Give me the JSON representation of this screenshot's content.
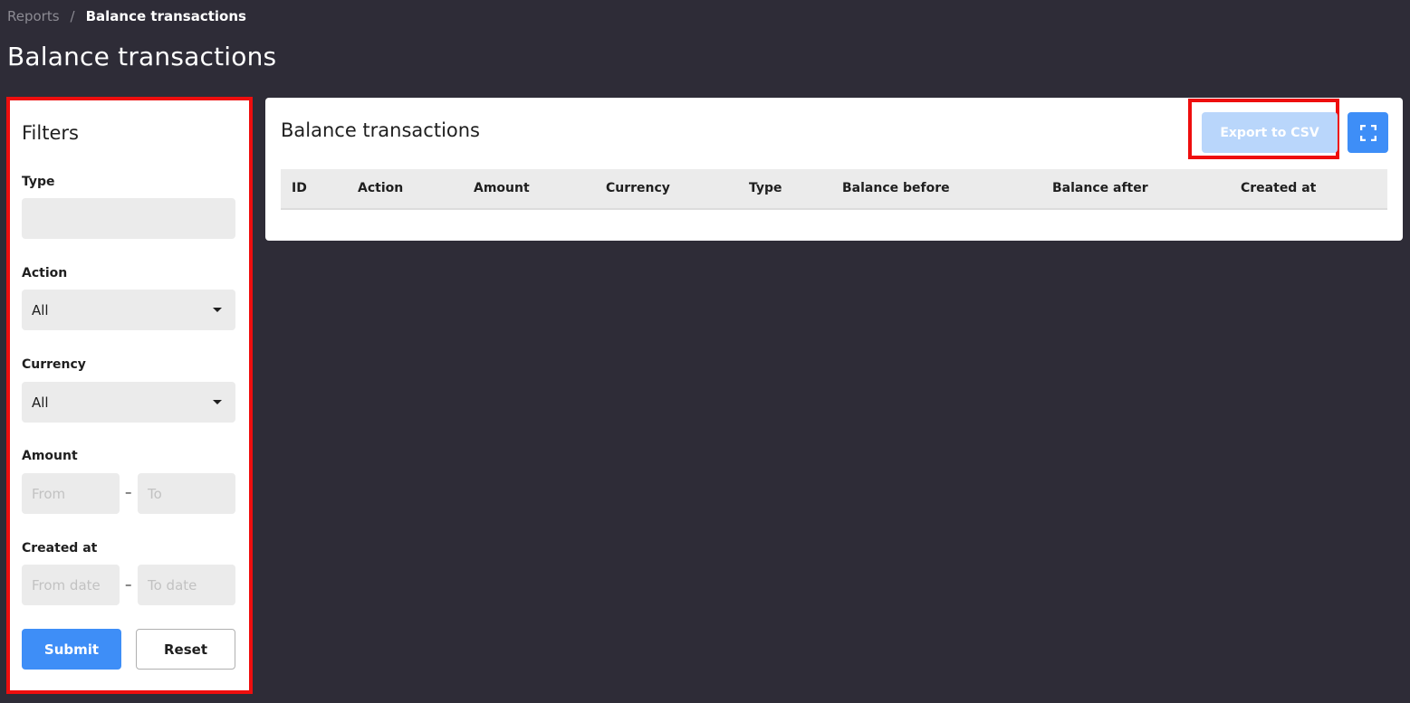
{
  "breadcrumb": {
    "parent": "Reports",
    "separator": "/",
    "current": "Balance transactions"
  },
  "page": {
    "title": "Balance transactions"
  },
  "filters": {
    "title": "Filters",
    "type": {
      "label": "Type",
      "value": ""
    },
    "action": {
      "label": "Action",
      "selected": "All"
    },
    "currency": {
      "label": "Currency",
      "selected": "All"
    },
    "amount": {
      "label": "Amount",
      "from_placeholder": "From",
      "to_placeholder": "To",
      "separator": "–"
    },
    "created_at": {
      "label": "Created at",
      "from_placeholder": "From date",
      "to_placeholder": "To date",
      "separator": "–"
    },
    "submit_label": "Submit",
    "reset_label": "Reset"
  },
  "card": {
    "title": "Balance transactions",
    "export_label": "Export to CSV",
    "columns": [
      "ID",
      "Action",
      "Amount",
      "Currency",
      "Type",
      "Balance before",
      "Balance after",
      "Created at"
    ]
  },
  "colors": {
    "background": "#2e2c37",
    "accent": "#3e8ef7",
    "highlight": "#ee0e0e"
  },
  "icons": {
    "fullscreen": "fullscreen-icon",
    "select_caret": "caret-down-icon"
  }
}
